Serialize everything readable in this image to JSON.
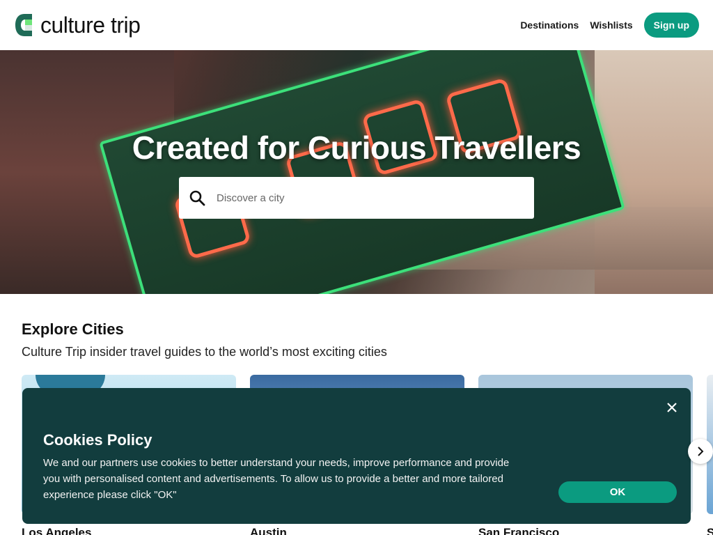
{
  "header": {
    "logo_text": "culture trip",
    "nav": [
      {
        "label": "Destinations"
      },
      {
        "label": "Wishlists"
      }
    ],
    "signup_label": "Sign up"
  },
  "hero": {
    "title": "Created for Curious Travellers",
    "search_placeholder": "Discover a city"
  },
  "explore": {
    "title": "Explore Cities",
    "subtitle": "Culture Trip insider travel guides to the world’s most exciting cities",
    "cities": [
      {
        "name": "Los Angeles"
      },
      {
        "name": "Austin"
      },
      {
        "name": "San Francisco"
      },
      {
        "name": "S"
      }
    ]
  },
  "cookie": {
    "title": "Cookies Policy",
    "body": "We and our partners use cookies to better understand your needs, improve performance and provide you with personalised content and advertisements. To allow us to provide a better and more tailored experience please click \"OK\"",
    "ok_label": "OK"
  },
  "colors": {
    "brand_green": "#0b9b80",
    "cookie_bg": "#123d3e"
  },
  "icons": [
    "culture-trip-logo-icon",
    "search-icon",
    "close-icon",
    "chevron-right-icon"
  ]
}
